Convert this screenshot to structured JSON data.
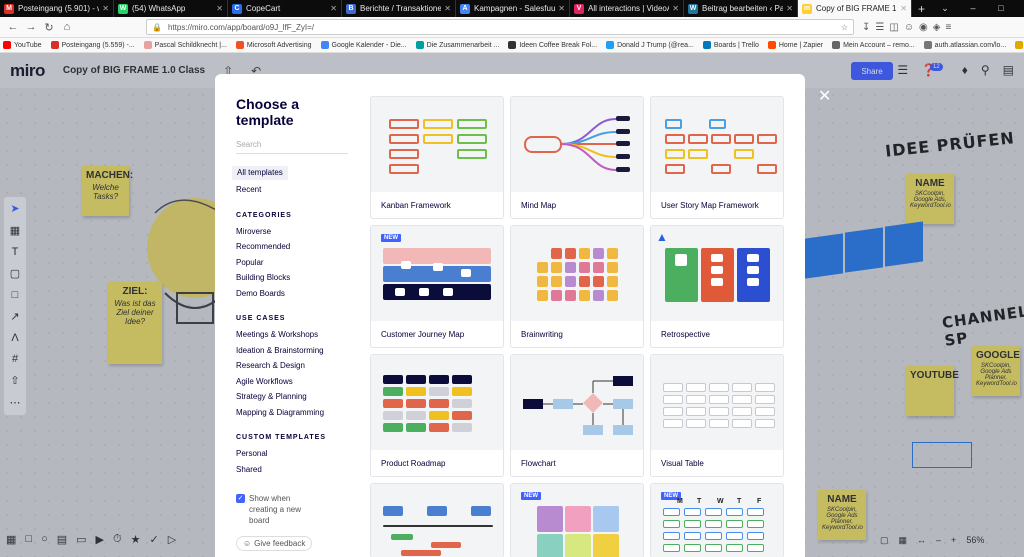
{
  "browser": {
    "tabs": [
      {
        "title": "Posteingang (5.901) - webco",
        "color": "#d93025",
        "glyph": "M"
      },
      {
        "title": "(54) WhatsApp",
        "color": "#25d366",
        "glyph": "W"
      },
      {
        "title": "CopeCart",
        "color": "#2b6de8",
        "glyph": "C"
      },
      {
        "title": "Berichte / Transaktionen - Di",
        "color": "#3c6ccf",
        "glyph": "B"
      },
      {
        "title": "Kampagnen - Salesfuu - Goo",
        "color": "#4285f4",
        "glyph": "A"
      },
      {
        "title": "All interactions | VideoAsk",
        "color": "#e0245e",
        "glyph": "V"
      },
      {
        "title": "Beitrag bearbeiten ‹ Pascal S",
        "color": "#21759b",
        "glyph": "W"
      },
      {
        "title": "Copy of BIG FRAME 1.0 Clas",
        "color": "#ffd02f",
        "glyph": "m"
      }
    ],
    "url": "https://miro.com/app/board/o9J_lfF_ZyI=/",
    "bookmarks": [
      {
        "label": "YouTube",
        "color": "#ff0000"
      },
      {
        "label": "Posteingang (5.559) -...",
        "color": "#d93025"
      },
      {
        "label": "Pascal Schildknecht |...",
        "color": "#e8a0a0"
      },
      {
        "label": "Microsoft Advertising",
        "color": "#f25022"
      },
      {
        "label": "Google Kalender - Die...",
        "color": "#4285f4"
      },
      {
        "label": "Die Zusammenarbeit ...",
        "color": "#00a0a0"
      },
      {
        "label": "Ideen Coffee Break Fol...",
        "color": "#333333"
      },
      {
        "label": "Donald J Trump (@rea...",
        "color": "#1da1f2"
      },
      {
        "label": "Boards | Trello",
        "color": "#0079bf"
      },
      {
        "label": "Home | Zapier",
        "color": "#ff4a00"
      },
      {
        "label": "Mein Account – remo...",
        "color": "#666666"
      },
      {
        "label": "auth.atlassian.com/lo...",
        "color": "#777777"
      },
      {
        "label": "Geld online überweise...",
        "color": "#e0a800"
      }
    ]
  },
  "miro": {
    "logo": "miro",
    "board_title": "Copy of BIG FRAME 1.0 Class",
    "share_label": "Share",
    "badge_count": "12",
    "zoom": "56%"
  },
  "canvas": {
    "stickies": {
      "machen_head": "MACHEN:",
      "machen_body": "Welche Tasks?",
      "ziel_head": "ZIEL:",
      "ziel_body": "Was ist das Ziel deiner Idee?",
      "name1_head": "NAME",
      "name1_body": "SKCoolpin, Google Ads, KeywordTool.io",
      "youtube_head": "YOUTUBE",
      "google_head": "GOOGLE",
      "google_body": "SKCoolpin, Google Ads Planner, KeywordTool.io",
      "name2_head": "NAME",
      "name2_body": "SKCoolpin, Google Ads Planner, KeywordTool.io"
    },
    "idee_pruefen": "IDEE PRÜFEN",
    "channel": "CHANNEL SP"
  },
  "modal": {
    "title": "Choose a template",
    "search_placeholder": "Search",
    "nav_all": "All templates",
    "nav_recent": "Recent",
    "categories_head": "CATEGORIES",
    "categories": [
      "Miroverse",
      "Recommended",
      "Popular",
      "Building Blocks",
      "Demo Boards"
    ],
    "use_cases_head": "USE CASES",
    "use_cases": [
      "Meetings & Workshops",
      "Ideation & Brainstorming",
      "Research & Design",
      "Agile Workflows",
      "Strategy & Planning",
      "Mapping & Diagramming"
    ],
    "custom_head": "CUSTOM TEMPLATES",
    "custom": [
      "Personal",
      "Shared"
    ],
    "show_when_creating": "Show when creating a new board",
    "feedback": "Give feedback",
    "new_tag": "NEW",
    "templates": [
      "Kanban Framework",
      "Mind Map",
      "User Story Map Framework",
      "Customer Journey Map",
      "Brainwriting",
      "Retrospective",
      "Product Roadmap",
      "Flowchart",
      "Visual Table"
    ],
    "weekdays": [
      "M",
      "T",
      "W",
      "T",
      "F"
    ]
  }
}
